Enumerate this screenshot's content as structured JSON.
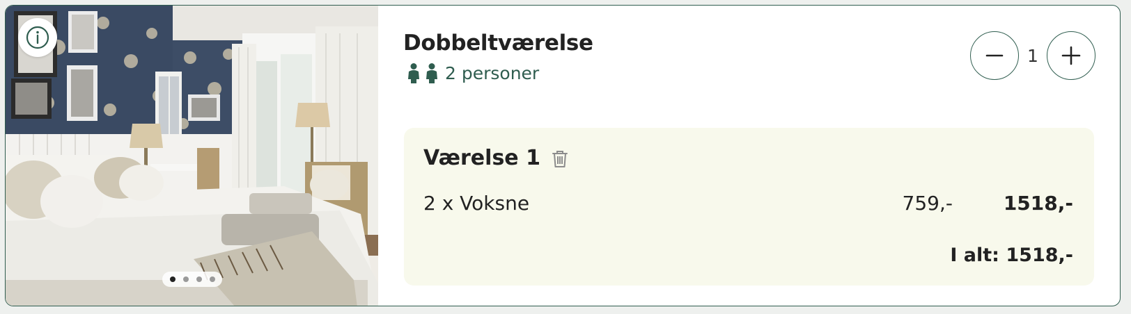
{
  "room": {
    "title": "Dobbeltværelse",
    "occupancy_label": "2 personer",
    "occupancy_icons": [
      "person-icon",
      "person-icon"
    ],
    "photo_alt": "Dobbeltværelse",
    "carousel": {
      "total": 4,
      "active_index": 0
    }
  },
  "stepper": {
    "quantity": "1",
    "decrement_icon": "minus-icon",
    "increment_icon": "plus-icon"
  },
  "booking": {
    "room_label": "Værelse 1",
    "delete_icon": "trash-icon",
    "line": {
      "description": "2 x Voksne",
      "unit_price": "759,-",
      "line_total": "1518,-"
    },
    "grand_total": "I alt: 1518,-"
  },
  "colors": {
    "accent": "#2f5d4f",
    "panel_bg": "#f8f9ec",
    "card_border": "#2f5d4f"
  }
}
